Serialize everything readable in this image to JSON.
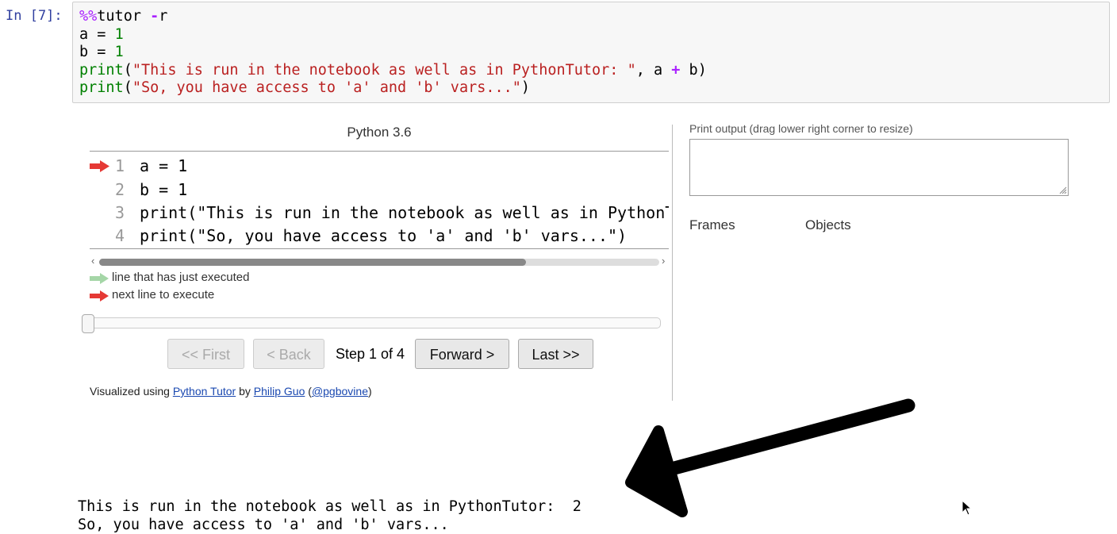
{
  "cell": {
    "prompt": "In [7]:",
    "code_lines": [
      [
        {
          "t": "%%",
          "c": "magic"
        },
        {
          "t": "tutor ",
          "c": ""
        },
        {
          "t": "-",
          "c": "op"
        },
        {
          "t": "r",
          "c": ""
        }
      ],
      [
        {
          "t": "a = ",
          "c": ""
        },
        {
          "t": "1",
          "c": "num"
        }
      ],
      [
        {
          "t": "b = ",
          "c": ""
        },
        {
          "t": "1",
          "c": "num"
        }
      ],
      [
        {
          "t": "print",
          "c": "bi"
        },
        {
          "t": "(",
          "c": ""
        },
        {
          "t": "\"This is run in the notebook as well as in PythonTutor: \"",
          "c": "str"
        },
        {
          "t": ", a ",
          "c": ""
        },
        {
          "t": "+",
          "c": "op"
        },
        {
          "t": " b)",
          "c": ""
        }
      ],
      [
        {
          "t": "print",
          "c": "bi"
        },
        {
          "t": "(",
          "c": ""
        },
        {
          "t": "\"So, you have access to 'a' and 'b' vars...\"",
          "c": "str"
        },
        {
          "t": ")",
          "c": ""
        }
      ]
    ]
  },
  "tutor": {
    "language": "Python 3.6",
    "code_lines": [
      {
        "num": "1",
        "text": "a = 1"
      },
      {
        "num": "2",
        "text": "b = 1"
      },
      {
        "num": "3",
        "text": "print(\"This is run in the notebook as well as in PythonTutor: \", a + b)"
      },
      {
        "num": "4",
        "text": "print(\"So, you have access to 'a' and 'b' vars...\")"
      }
    ],
    "current_line": 1,
    "legend_executed": "line that has just executed",
    "legend_next": "next line to execute",
    "step_progress": 0,
    "buttons": {
      "first": "<< First",
      "back": "< Back",
      "forward": "Forward >",
      "last": "Last >>"
    },
    "step_text": "Step 1 of 4",
    "credits": {
      "prefix": "Visualized using ",
      "link1": "Python Tutor",
      "mid": " by ",
      "link2": "Philip Guo",
      "paren_open": " (",
      "link3": "@pgbovine",
      "paren_close": ")"
    },
    "print_output_label": "Print output (drag lower right corner to resize)",
    "print_output_value": "",
    "frames_label": "Frames",
    "objects_label": "Objects"
  },
  "output": {
    "lines": [
      "This is run in the notebook as well as in PythonTutor:  2",
      "So, you have access to 'a' and 'b' vars..."
    ]
  },
  "colors": {
    "next_arrow": "#e53935",
    "executed_arrow": "#a5d6a7",
    "link": "#1a48b0",
    "prompt": "#303f9f"
  }
}
